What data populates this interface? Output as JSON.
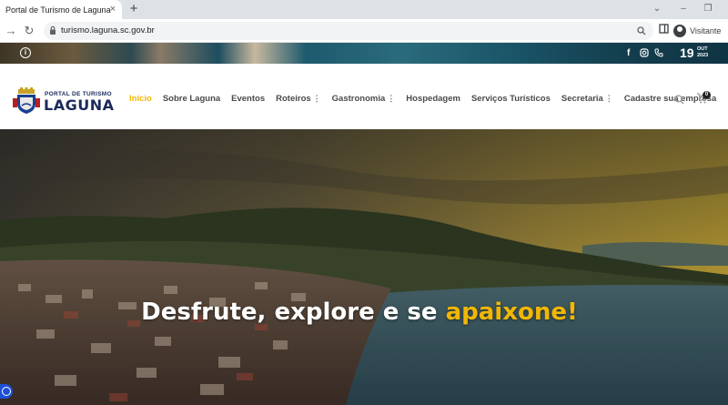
{
  "browser": {
    "tab_title": "Portal de Turismo de Laguna",
    "close_glyph": "×",
    "new_tab_glyph": "+",
    "url": "turismo.laguna.sc.gov.br",
    "profile_label": "Visitante",
    "icons": [
      "back-icon",
      "forward-icon",
      "reload-icon",
      "lock-icon",
      "zoom-icon",
      "sidebar-icon",
      "account-icon"
    ]
  },
  "top_strip": {
    "date_day": "19",
    "date_month": "OUT",
    "date_year": "2023",
    "social": [
      "facebook-icon",
      "instagram-icon",
      "phone-icon"
    ]
  },
  "header": {
    "logo_top": "PORTAL DE TURISMO",
    "logo_main": "LAGUNA",
    "menu": [
      {
        "label": "Início"
      },
      {
        "label": "Sobre Laguna"
      },
      {
        "label": "Eventos"
      },
      {
        "label": "Roteiros"
      },
      {
        "label": "Gastronomia"
      },
      {
        "label": "Hospedagem"
      },
      {
        "label": "Serviços Turísticos"
      },
      {
        "label": "Secretaria"
      },
      {
        "label": "Cadastre sua empresa"
      }
    ],
    "cart_count": "0"
  },
  "hero": {
    "headline_prefix": "Desfrute, explore e se ",
    "headline_highlight": "apaixone!"
  },
  "colors": {
    "accent": "#f2b705",
    "brand_navy": "#1b2a5a",
    "menu_text": "#4a4a4a"
  }
}
